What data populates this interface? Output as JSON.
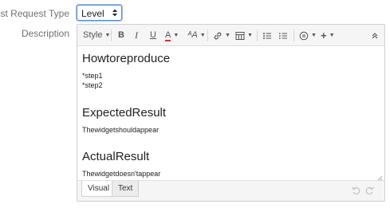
{
  "form": {
    "type_label": "Test Request Type",
    "type_value": "Level",
    "desc_label": "Description"
  },
  "toolbar": {
    "style_label": "Style",
    "bold": "B",
    "italic": "I",
    "underline": "U",
    "text_color": "A",
    "text_size": "ᴬA",
    "add": "+"
  },
  "content": {
    "h1": "Howtoreproduce",
    "step1": "*step1",
    "step2": "*step2",
    "h2": "ExpectedResult",
    "p2": "Thewidgetshouldappear",
    "h3": "ActualResult",
    "p3": "Thewidgetdoesn'tappear"
  },
  "tabs": {
    "visual": "Visual",
    "text": "Text"
  },
  "colors": {
    "accent": "#5c8fd6",
    "text_color_bar": "#d0312d"
  }
}
